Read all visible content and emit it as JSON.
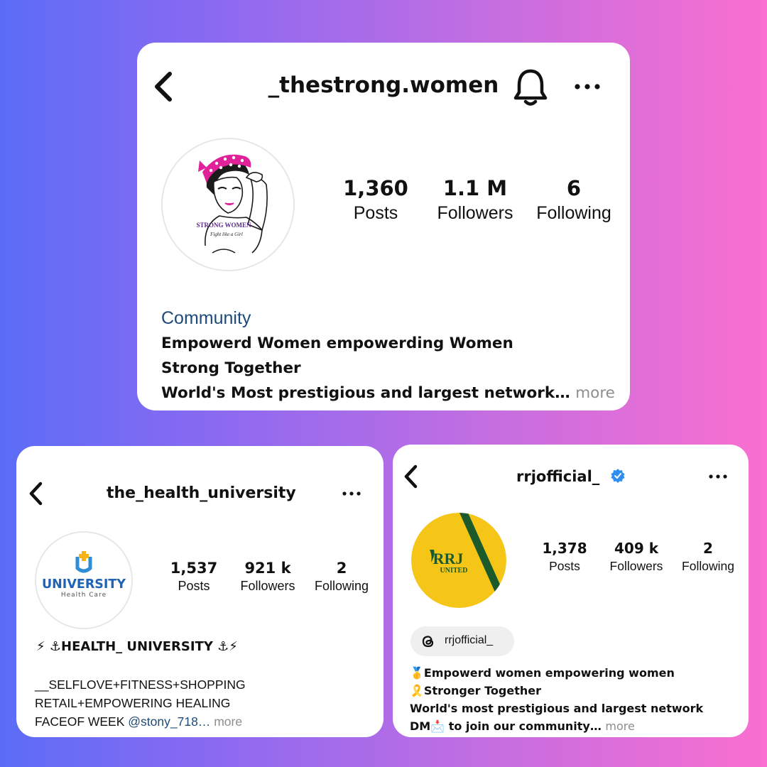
{
  "profiles": [
    {
      "username": "_thestrong.women",
      "stats": [
        {
          "value": "1,360",
          "label": "Posts"
        },
        {
          "value": "1.1 M",
          "label": "Followers"
        },
        {
          "value": "6",
          "label": "Following"
        }
      ],
      "category": "Community",
      "bio_lines": [
        "Empowerd Women empowerding Women",
        "Strong Together",
        "World's Most prestigious and largest network…"
      ],
      "more_label": "more",
      "avatar_logo_line1": "STRONG WOMEN",
      "avatar_logo_line2": "Fight like a Girl",
      "icons": [
        "back-chevron-icon",
        "bell-icon",
        "more-options-icon"
      ]
    },
    {
      "username": "the_health_university",
      "stats": [
        {
          "value": "1,537",
          "label": "Posts"
        },
        {
          "value": "921 k",
          "label": "Followers"
        },
        {
          "value": "2",
          "label": "Following"
        }
      ],
      "bio_heading": "⚡ ⚓HEALTH_ UNIVERSITY ⚓⚡",
      "bio_lines": [
        "__SELFLOVE+FITNESS+SHOPPING",
        "RETAIL+EMPOWERING HEALING"
      ],
      "bio_last_prefix": "FACEOF WEEK ",
      "bio_mention": "@stony_718…",
      "more_label": "more",
      "avatar_logo_line1": "UNIVERSITY",
      "avatar_logo_line2": "Health Care",
      "icons": [
        "back-chevron-icon",
        "more-options-icon"
      ]
    },
    {
      "username": "rrjofficial_",
      "verified": true,
      "stats": [
        {
          "value": "1,378",
          "label": "Posts"
        },
        {
          "value": "409 k",
          "label": "Followers"
        },
        {
          "value": "2",
          "label": "Following"
        }
      ],
      "threads_handle": "rrjofficial_",
      "bio_lines": [
        "🥇Empowerd women empowering women",
        "🎗️Stronger Together",
        "World's most prestigious and largest network"
      ],
      "bio_last_prefix": "DM📩 to join our community…",
      "more_label": "more",
      "avatar_logo_line1": "RRJ",
      "avatar_logo_line2": "UNITED",
      "icons": [
        "back-chevron-icon",
        "verified-badge-icon",
        "more-options-icon",
        "threads-icon"
      ]
    }
  ],
  "colors": {
    "category": "#1d4a78",
    "more": "#8e8e8e",
    "verified": "#2f8ff0",
    "rrj_yellow": "#f5c518",
    "rrj_green": "#1d5a2b",
    "strong_pink": "#e0219a"
  }
}
